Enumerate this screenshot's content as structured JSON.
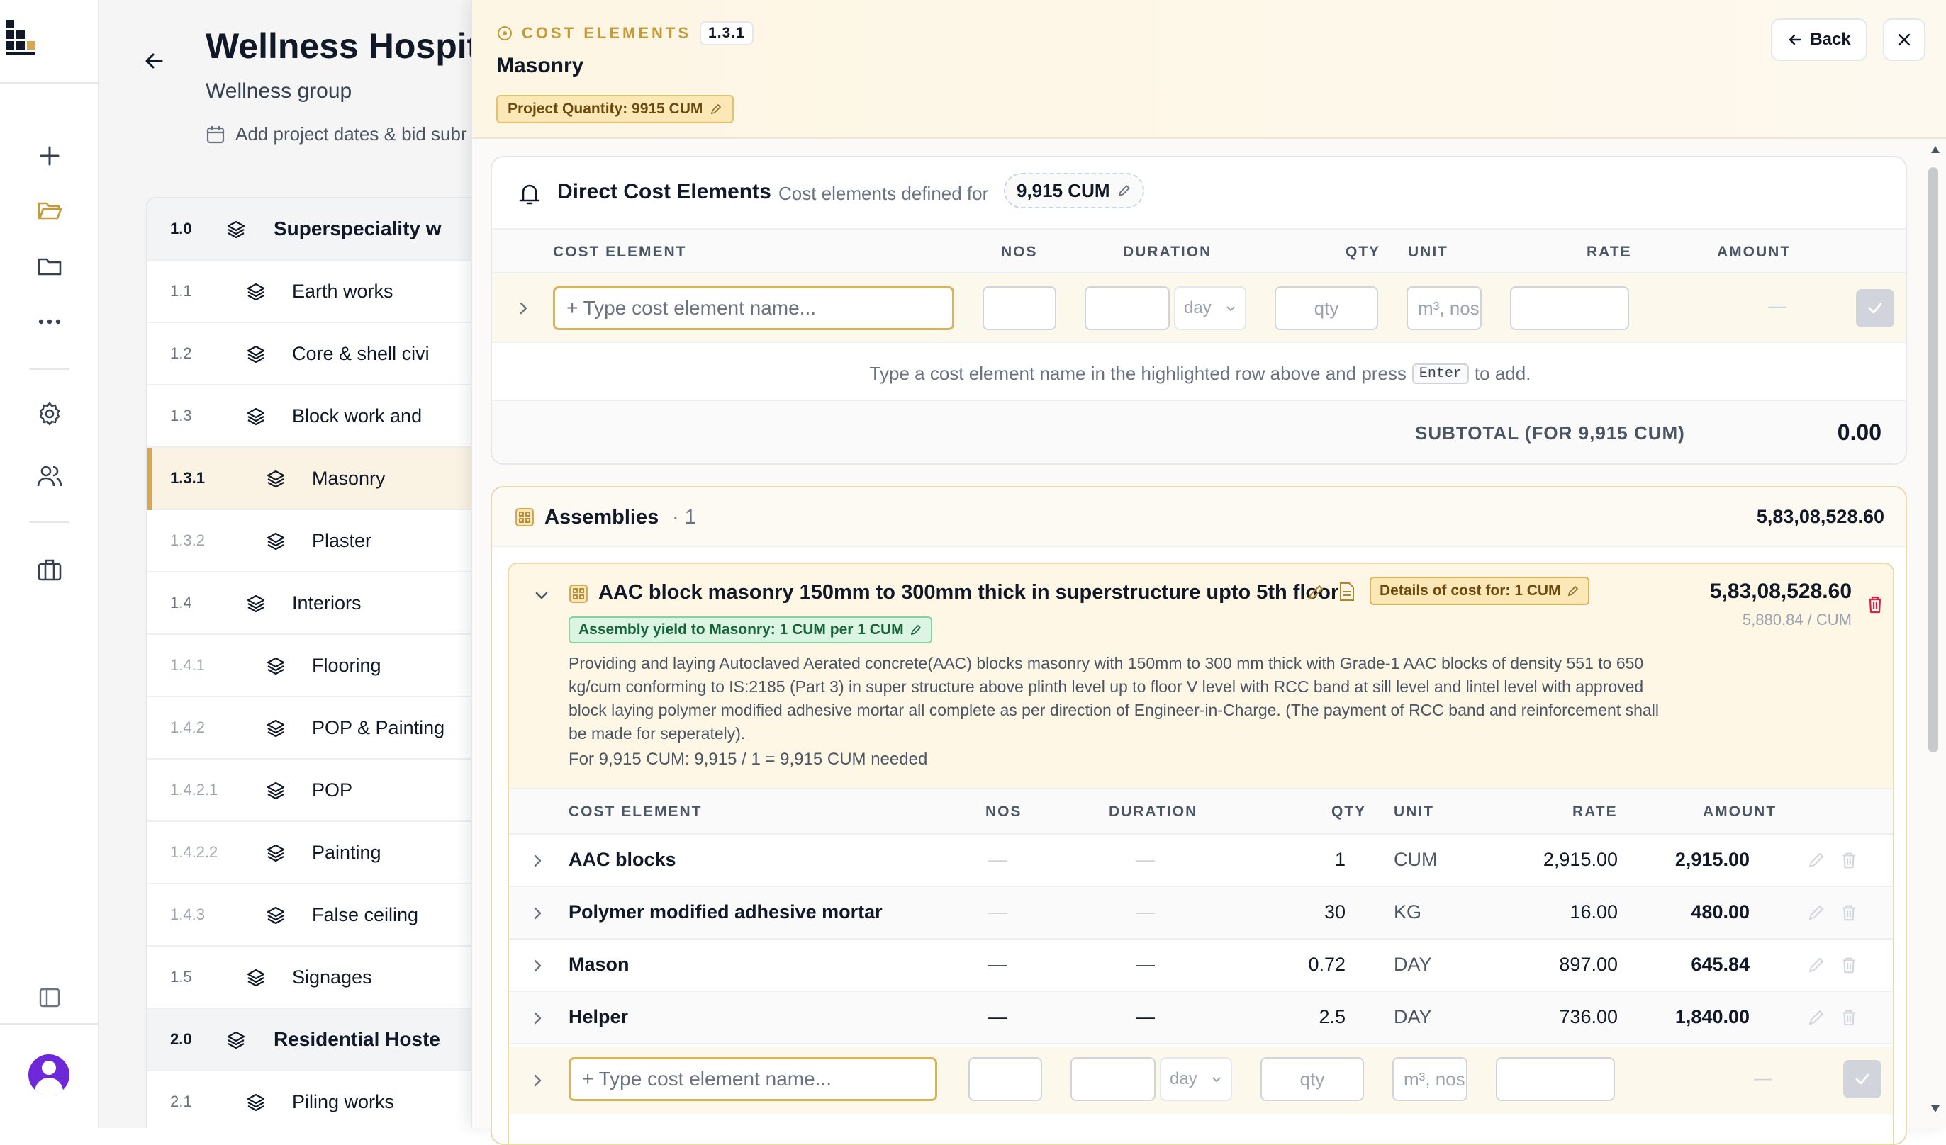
{
  "project": {
    "title": "Wellness Hospit",
    "subtitle": "Wellness group",
    "dates_link": "Add project dates & bid subr"
  },
  "tree": [
    {
      "num": "1.0",
      "label": "Superspeciality w"
    },
    {
      "num": "1.1",
      "label": "Earth works"
    },
    {
      "num": "1.2",
      "label": "Core & shell civi"
    },
    {
      "num": "1.3",
      "label": "Block work and"
    },
    {
      "num": "1.3.1",
      "label": "Masonry"
    },
    {
      "num": "1.3.2",
      "label": "Plaster"
    },
    {
      "num": "1.4",
      "label": "Interiors"
    },
    {
      "num": "1.4.1",
      "label": "Flooring"
    },
    {
      "num": "1.4.2",
      "label": "POP & Painting"
    },
    {
      "num": "1.4.2.1",
      "label": "POP"
    },
    {
      "num": "1.4.2.2",
      "label": "Painting"
    },
    {
      "num": "1.4.3",
      "label": "False ceiling"
    },
    {
      "num": "1.5",
      "label": "Signages"
    },
    {
      "num": "2.0",
      "label": "Residential Hoste"
    },
    {
      "num": "2.1",
      "label": "Piling works"
    }
  ],
  "panel": {
    "eyebrow": "COST ELEMENTS",
    "code": "1.3.1",
    "title": "Masonry",
    "project_quantity": "Project Quantity: 9915 CUM",
    "back_label": "Back"
  },
  "direct": {
    "title": "Direct Cost Elements",
    "desc": "Cost elements defined for",
    "qty_chip": "9,915 CUM",
    "columns": {
      "element": "COST ELEMENT",
      "nos": "NOS",
      "duration": "DURATION",
      "qty": "QTY",
      "unit": "UNIT",
      "rate": "RATE",
      "amount": "AMOUNT"
    },
    "input": {
      "name_placeholder": "+ Type cost element name...",
      "duration_unit": "day",
      "qty_placeholder": "qty",
      "unit_placeholder": "m³, nos",
      "amount_placeholder": "—"
    },
    "hint_pre": "Type a cost element name in the highlighted row above and press",
    "hint_key": "Enter",
    "hint_post": "to add.",
    "subtotal_label": "SUBTOTAL (FOR 9,915 CUM)",
    "subtotal_value": "0.00"
  },
  "assemblies": {
    "title": "Assemblies",
    "count": "· 1",
    "total": "5,83,08,528.60",
    "item": {
      "title": "AAC block masonry 150mm to 300mm thick in superstructure upto 5th floor",
      "details_chip": "Details of cost for: 1 CUM",
      "yield_chip": "Assembly yield to Masonry: 1 CUM per 1 CUM",
      "description": "Providing and laying Autoclaved Aerated concrete(AAC) blocks masonry with 150mm to 300 mm thick with Grade-1 AAC blocks of density 551 to 650 kg/cum conforming to IS:2185 (Part 3) in super structure above plinth level up to floor V level with RCC band at sill level and lintel level with approved block laying polymer modified adhesive mortar all complete as per direction of Engineer-in-Charge. (The payment of RCC band and reinforcement shall be made for seperately).",
      "for_line": "For 9,915 CUM: 9,915 / 1 = 9,915 CUM needed",
      "amount": "5,83,08,528.60",
      "per_unit": "5,880.84 / CUM",
      "rows": [
        {
          "name": "AAC blocks",
          "nos": "—",
          "duration": "—",
          "qty": "1",
          "unit": "CUM",
          "rate": "2,915.00",
          "amount": "2,915.00"
        },
        {
          "name": "Polymer modified adhesive mortar",
          "nos": "—",
          "duration": "—",
          "qty": "30",
          "unit": "KG",
          "rate": "16.00",
          "amount": "480.00"
        },
        {
          "name": "Mason",
          "nos": "—",
          "duration": "—",
          "qty": "0.72",
          "unit": "DAY",
          "rate": "897.00",
          "amount": "645.84"
        },
        {
          "name": "Helper",
          "nos": "—",
          "duration": "—",
          "qty": "2.5",
          "unit": "DAY",
          "rate": "736.00",
          "amount": "1,840.00"
        }
      ]
    }
  },
  "colors": {
    "accent_gold": "#d4a757",
    "avatar": "#6d28d9",
    "yield_green": "#17643a",
    "trash_red": "#e11d48"
  }
}
